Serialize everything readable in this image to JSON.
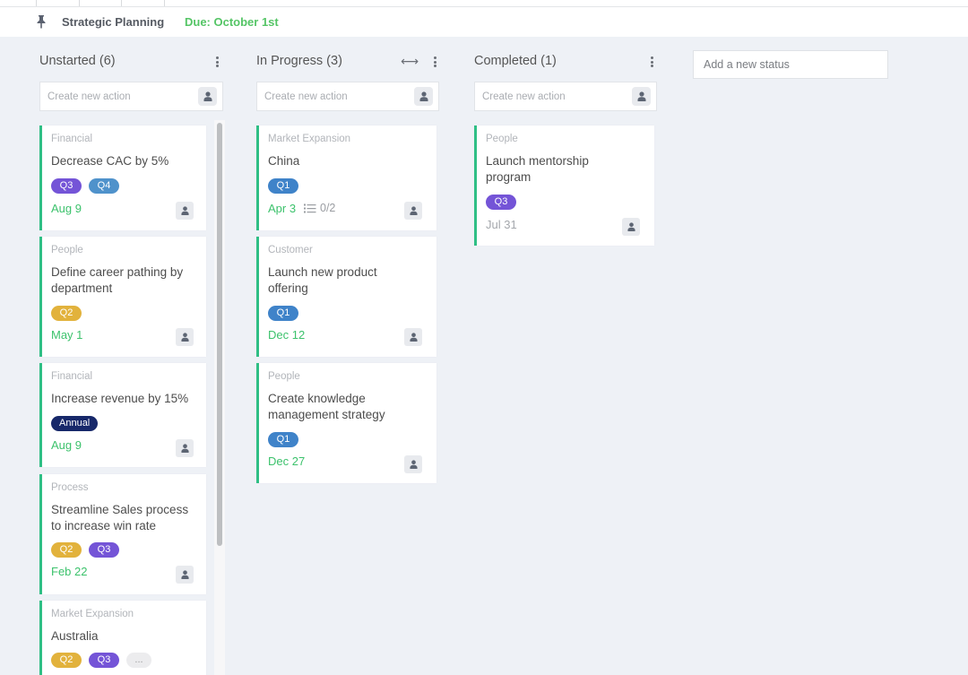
{
  "header": {
    "title": "Strategic Planning",
    "due": "Due: October 1st",
    "icon": "pin-icon"
  },
  "colors": {
    "accent_green": "#3cc26c",
    "card_border": "#2fbf85",
    "tag_q1": "#3f83c9",
    "tag_q2": "#e2b23c",
    "tag_q3": "#7454d7",
    "tag_q4": "#4f92cb",
    "tag_annual": "#17286a"
  },
  "columns": [
    {
      "title": "Unstarted (6)",
      "create_placeholder": "Create new action",
      "cards": [
        {
          "category": "Financial",
          "title": "Decrease CAC by 5%",
          "tags": [
            "Q3",
            "Q4"
          ],
          "date": "Aug 9"
        },
        {
          "category": "People",
          "title": "Define career pathing by department",
          "tags": [
            "Q2"
          ],
          "date": "May 1"
        },
        {
          "category": "Financial",
          "title": "Increase revenue by 15%",
          "tags": [
            "Annual"
          ],
          "date": "Aug 9"
        },
        {
          "category": "Process",
          "title": "Streamline Sales process to increase win rate",
          "tags": [
            "Q2",
            "Q3"
          ],
          "date": "Feb 22"
        },
        {
          "category": "Market Expansion",
          "title": "Australia",
          "tags": [
            "Q2",
            "Q3",
            "..."
          ],
          "date": ""
        }
      ]
    },
    {
      "title": "In Progress (3)",
      "create_placeholder": "Create new action",
      "cards": [
        {
          "category": "Market Expansion",
          "title": "China",
          "tags": [
            "Q1"
          ],
          "date": "Apr 3",
          "subtasks": "0/2"
        },
        {
          "category": "Customer",
          "title": "Launch new product offering",
          "tags": [
            "Q1"
          ],
          "date": "Dec 12"
        },
        {
          "category": "People",
          "title": "Create knowledge management strategy",
          "tags": [
            "Q1"
          ],
          "date": "Dec 27"
        }
      ]
    },
    {
      "title": "Completed (1)",
      "create_placeholder": "Create new action",
      "cards": [
        {
          "category": "People",
          "title": "Launch mentorship program",
          "tags": [
            "Q3"
          ],
          "date": "Jul 31"
        }
      ]
    }
  ],
  "add_status": {
    "placeholder": "Add a new status"
  },
  "icons": {
    "column_menu": "kebab-menu-icon",
    "expand": "expand-horizontal-icon",
    "assignee": "person-icon",
    "subtasks": "checklist-icon"
  }
}
